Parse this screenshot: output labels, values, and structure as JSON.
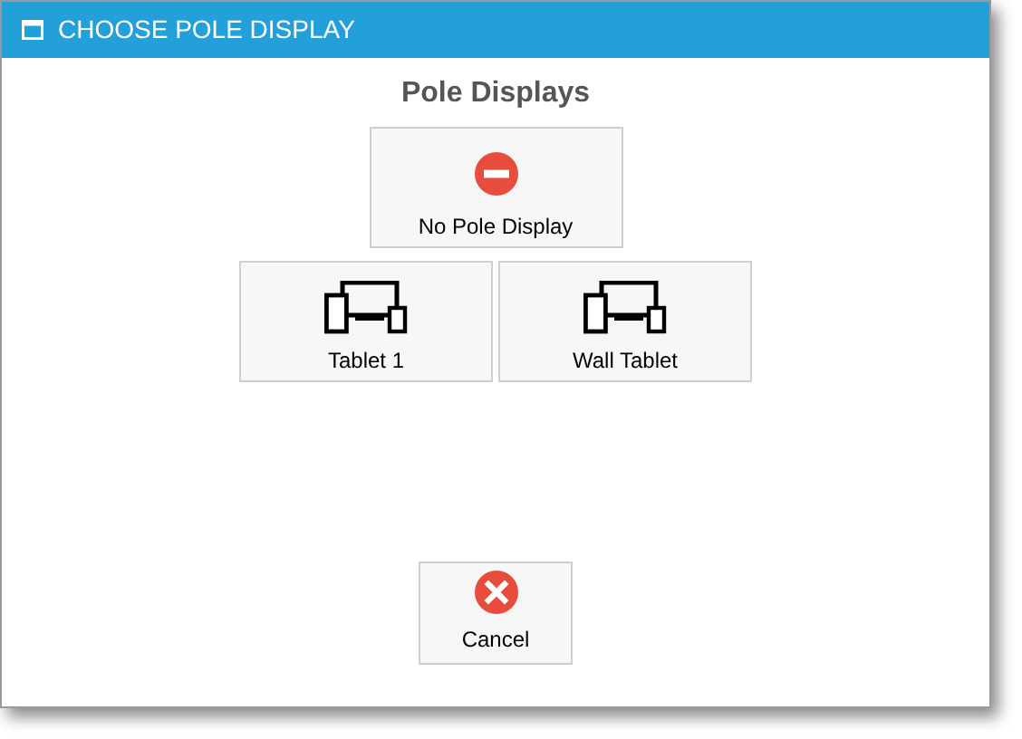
{
  "window": {
    "title": "CHOOSE POLE DISPLAY"
  },
  "heading": "Pole Displays",
  "options": [
    {
      "label": "No Pole Display",
      "kind": "none"
    },
    {
      "label": "Tablet 1",
      "kind": "device"
    },
    {
      "label": "Wall Tablet",
      "kind": "device"
    }
  ],
  "cancel_button": {
    "label": "Cancel"
  }
}
